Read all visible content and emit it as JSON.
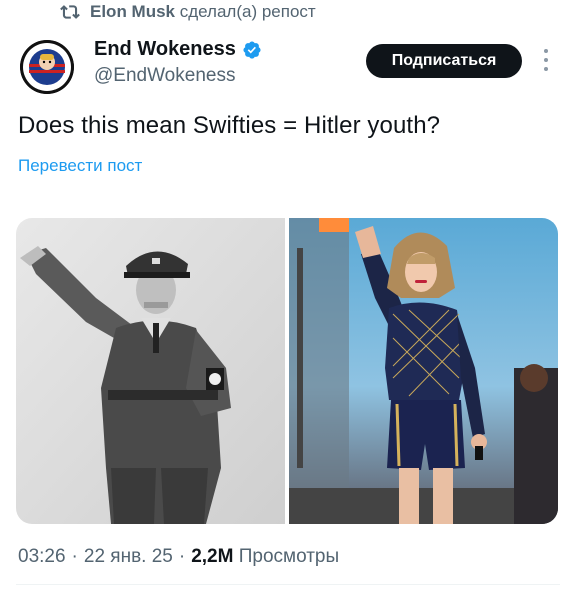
{
  "repost": {
    "icon": "repost-icon",
    "user": "Elon Musk",
    "text": "сделал(а) репост"
  },
  "author": {
    "avatar": "avatar",
    "display_name": "End Wokeness",
    "handle": "@EndWokeness",
    "verified_icon": "verified-badge-icon"
  },
  "follow_label": "Подписаться",
  "more_icon": "more-options-icon",
  "tweet_text": "Does this mean Swifties = Hitler youth?",
  "translate_label": "Перевести пост",
  "media": [
    {
      "name": "photo-left",
      "desc": "black and white photograph of a man in uniform saluting"
    },
    {
      "name": "photo-right",
      "desc": "performer on stage raising her hand"
    }
  ],
  "meta": {
    "time": "03:26",
    "date": "22 янв. 25",
    "views_count": "2,2M",
    "views_label": "Просмотры",
    "sep": "·"
  },
  "colors": {
    "accent": "#1d9bf0",
    "button_bg": "#0f1419",
    "muted": "#536471"
  }
}
